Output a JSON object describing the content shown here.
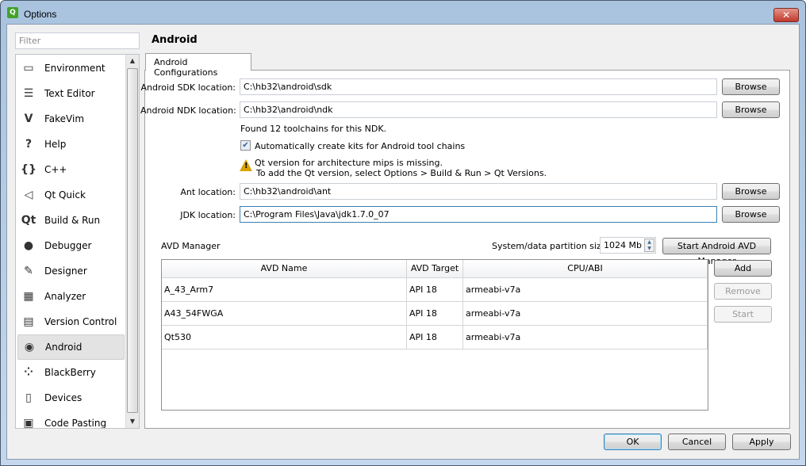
{
  "window": {
    "title": "Options",
    "close_glyph": "✕"
  },
  "sidebar": {
    "filter_placeholder": "Filter",
    "items": [
      {
        "label": "Environment",
        "icon": "monitor-icon",
        "glyph": "▭"
      },
      {
        "label": "Text Editor",
        "icon": "text-editor-icon",
        "glyph": "☰"
      },
      {
        "label": "FakeVim",
        "icon": "fakevim-icon",
        "glyph": "V"
      },
      {
        "label": "Help",
        "icon": "help-icon",
        "glyph": "?"
      },
      {
        "label": "C++",
        "icon": "cpp-icon",
        "glyph": "{}"
      },
      {
        "label": "Qt Quick",
        "icon": "qt-quick-icon",
        "glyph": "◁"
      },
      {
        "label": "Build & Run",
        "icon": "build-run-icon",
        "glyph": "Qt"
      },
      {
        "label": "Debugger",
        "icon": "debugger-icon",
        "glyph": "●"
      },
      {
        "label": "Designer",
        "icon": "designer-icon",
        "glyph": "✎"
      },
      {
        "label": "Analyzer",
        "icon": "analyzer-icon",
        "glyph": "▦"
      },
      {
        "label": "Version Control",
        "icon": "version-control-icon",
        "glyph": "▤"
      },
      {
        "label": "Android",
        "icon": "android-icon",
        "glyph": "◉",
        "selected": true
      },
      {
        "label": "BlackBerry",
        "icon": "blackberry-icon",
        "glyph": "⁘"
      },
      {
        "label": "Devices",
        "icon": "devices-icon",
        "glyph": "▯"
      },
      {
        "label": "Code Pasting",
        "icon": "code-pasting-icon",
        "glyph": "▣"
      }
    ]
  },
  "page": {
    "title": "Android",
    "tab": "Android Configurations"
  },
  "config": {
    "sdk_label": "Android SDK location:",
    "sdk_value": "C:\\hb32\\android\\sdk",
    "ndk_label": "Android NDK location:",
    "ndk_value": "C:\\hb32\\android\\ndk",
    "browse": "Browse",
    "found": "Found 12 toolchains for this NDK.",
    "auto_kits": "Automatically create kits for Android tool chains",
    "auto_kits_checked": true,
    "warning_line1": "Qt version for architecture mips is missing.",
    "warning_line2": "To add the Qt version, select Options > Build & Run > Qt Versions.",
    "ant_label": "Ant location:",
    "ant_value": "C:\\hb32\\android\\ant",
    "jdk_label": "JDK location:",
    "jdk_value": "C:\\Program Files\\Java\\jdk1.7.0_07"
  },
  "avd": {
    "title": "AVD Manager",
    "partition_label": "System/data partition size:",
    "partition_value": "1024 Mb",
    "start_manager": "Start Android AVD Manager",
    "columns": [
      "AVD Name",
      "AVD Target",
      "CPU/ABI"
    ],
    "rows": [
      [
        "A_43_Arm7",
        "API 18",
        "armeabi-v7a"
      ],
      [
        "A43_54FWGA",
        "API 18",
        "armeabi-v7a"
      ],
      [
        "Qt530",
        "API 18",
        "armeabi-v7a"
      ]
    ],
    "add": "Add",
    "remove": "Remove",
    "start": "Start"
  },
  "footer": {
    "ok": "OK",
    "cancel": "Cancel",
    "apply": "Apply"
  }
}
